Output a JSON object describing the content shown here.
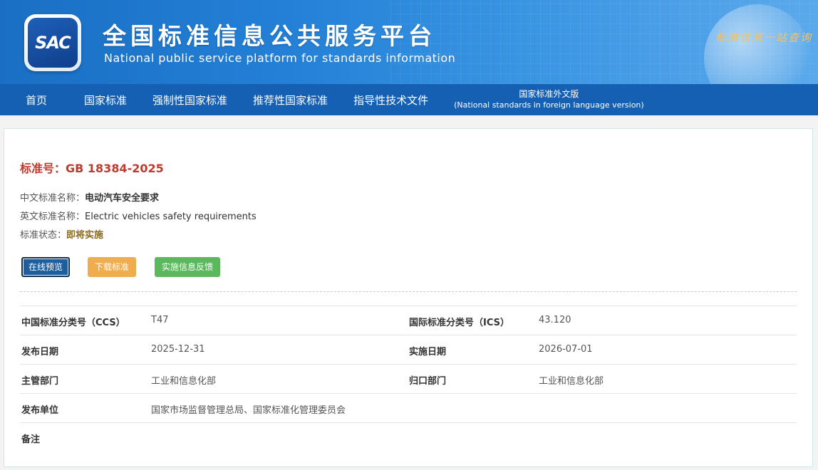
{
  "header": {
    "logo_text": "SAC",
    "title": "全国标准信息公共服务平台",
    "subtitle": "National public service platform  for standards information",
    "slogan": "标准信息一站查询"
  },
  "nav": {
    "items": [
      {
        "label": "首页"
      },
      {
        "label": "国家标准"
      },
      {
        "label": "强制性国家标准"
      },
      {
        "label": "推荐性国家标准"
      },
      {
        "label": "指导性技术文件"
      }
    ],
    "foreign": {
      "label": "国家标准外文版",
      "sub": "(National standards in foreign language version)"
    }
  },
  "standard": {
    "number_label": "标准号：",
    "number": "GB 18384-2025",
    "cn_name_label": "中文标准名称：",
    "cn_name": "电动汽车安全要求",
    "en_name_label": "英文标准名称：",
    "en_name": "Electric vehicles safety requirements",
    "status_label": "标准状态：",
    "status": "即将实施"
  },
  "buttons": {
    "preview": "在线预览",
    "download": "下载标准",
    "feedback": "实施信息反馈"
  },
  "meta": {
    "ccs_label": "中国标准分类号（CCS）",
    "ccs": "T47",
    "ics_label": "国际标准分类号（ICS）",
    "ics": "43.120",
    "publish_date_label": "发布日期",
    "publish_date": "2025-12-31",
    "impl_date_label": "实施日期",
    "impl_date": "2026-07-01",
    "dept_label": "主管部门",
    "dept": "工业和信息化部",
    "owner_label": "归口部门",
    "owner": "工业和信息化部",
    "publisher_label": "发布单位",
    "publisher": "国家市场监督管理总局、国家标准化管理委员会",
    "remark_label": "备注",
    "remark": ""
  },
  "colors": {
    "nav_bg": "#1560b3",
    "title_red": "#c0392b",
    "btn_preview": "#1d5e9e",
    "btn_download": "#f0ad4e",
    "btn_feedback": "#5cb85c"
  }
}
